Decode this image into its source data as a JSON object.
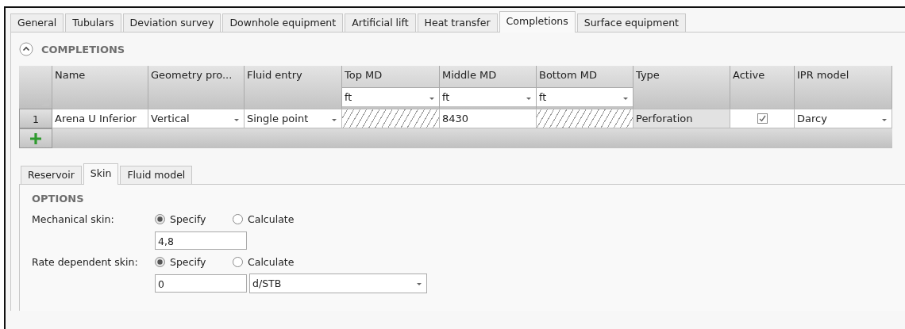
{
  "tabs": [
    {
      "label": "General",
      "selected": false
    },
    {
      "label": "Tubulars",
      "selected": false
    },
    {
      "label": "Deviation survey",
      "selected": false
    },
    {
      "label": "Downhole equipment",
      "selected": false
    },
    {
      "label": "Artificial lift",
      "selected": false
    },
    {
      "label": "Heat transfer",
      "selected": false
    },
    {
      "label": "Completions",
      "selected": true
    },
    {
      "label": "Surface equipment",
      "selected": false
    }
  ],
  "section": {
    "title": "COMPLETIONS",
    "expanded": true
  },
  "table": {
    "columns": [
      {
        "label": "Name"
      },
      {
        "label": "Geometry pro..."
      },
      {
        "label": "Fluid entry"
      },
      {
        "label": "Top MD",
        "unit": "ft"
      },
      {
        "label": "Middle MD",
        "unit": "ft"
      },
      {
        "label": "Bottom MD",
        "unit": "ft"
      },
      {
        "label": "Type"
      },
      {
        "label": "Active"
      },
      {
        "label": "IPR model"
      }
    ],
    "rows": [
      {
        "number": "1",
        "cells": [
          {
            "kind": "text",
            "value": "Arena U Inferior"
          },
          {
            "kind": "dropdown",
            "value": "Vertical"
          },
          {
            "kind": "dropdown",
            "value": "Single point"
          },
          {
            "kind": "hatched"
          },
          {
            "kind": "text",
            "value": "8430"
          },
          {
            "kind": "hatched"
          },
          {
            "kind": "readonly",
            "value": "Perforation"
          },
          {
            "kind": "checkbox",
            "checked": true
          },
          {
            "kind": "dropdown",
            "value": "Darcy"
          }
        ]
      }
    ]
  },
  "subtabs": [
    {
      "label": "Reservoir",
      "selected": false
    },
    {
      "label": "Skin",
      "selected": true
    },
    {
      "label": "Fluid model",
      "selected": false
    }
  ],
  "options": {
    "title": "OPTIONS",
    "rows": [
      {
        "label": "Mechanical skin:",
        "radios": [
          {
            "label": "Specify",
            "selected": true
          },
          {
            "label": "Calculate",
            "selected": false
          }
        ],
        "value": "4,8"
      },
      {
        "label": "Rate dependent skin:",
        "radios": [
          {
            "label": "Specify",
            "selected": true
          },
          {
            "label": "Calculate",
            "selected": false
          }
        ],
        "value": "0",
        "unit": "d/STB"
      }
    ]
  }
}
